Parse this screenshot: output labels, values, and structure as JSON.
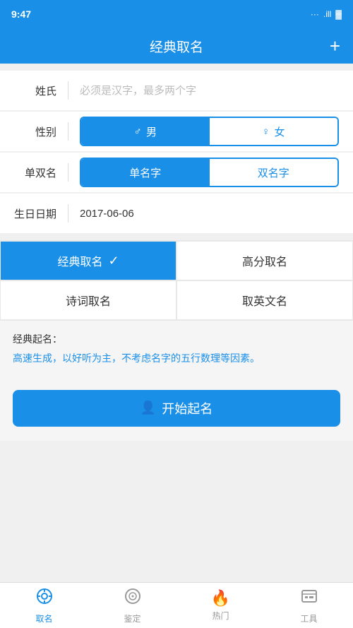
{
  "statusBar": {
    "time": "9:47",
    "icons": "... .ill 🔋"
  },
  "header": {
    "title": "经典取名",
    "plusLabel": "+"
  },
  "form": {
    "surnameLabel": "姓氏",
    "surnamePlaceholder": "必须是汉字，最多两个字",
    "genderLabel": "性别",
    "genderMale": "♂ 男",
    "genderFemale": "♀ 女",
    "singleDoubleLabel": "单双名",
    "singleName": "单名字",
    "doubleName": "双名字",
    "birthdayLabel": "生日日期",
    "birthdayValue": "2017-06-06"
  },
  "namingTypes": [
    {
      "id": "classic",
      "label": "经典取名",
      "active": true
    },
    {
      "id": "highscore",
      "label": "高分取名",
      "active": false
    },
    {
      "id": "poetry",
      "label": "诗词取名",
      "active": false
    },
    {
      "id": "english",
      "label": "取英文名",
      "active": false
    }
  ],
  "description": {
    "title": "经典起名：",
    "text": "高速生成，以好听为主，不考虑名字的五行数理等因素。"
  },
  "startButton": {
    "label": "开始起名"
  },
  "tabBar": {
    "items": [
      {
        "id": "naming",
        "icon": "⊙",
        "label": "取名",
        "active": true
      },
      {
        "id": "appraise",
        "icon": "◎",
        "label": "鉴定",
        "active": false
      },
      {
        "id": "hot",
        "icon": "🔥",
        "label": "热门",
        "active": false
      },
      {
        "id": "tools",
        "icon": "🧰",
        "label": "工具",
        "active": false
      }
    ]
  }
}
